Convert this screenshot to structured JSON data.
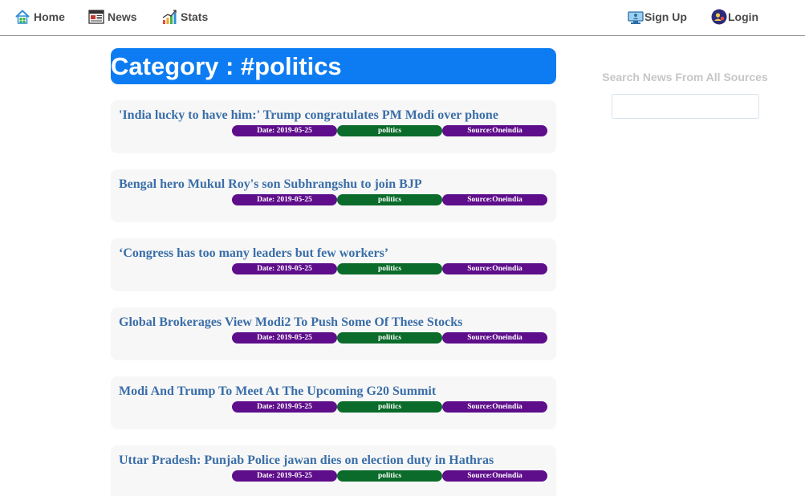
{
  "nav": {
    "left": [
      {
        "label": "Home",
        "icon": "home-icon"
      },
      {
        "label": "News",
        "icon": "newspaper-icon"
      },
      {
        "label": "Stats",
        "icon": "chart-icon"
      }
    ],
    "right": [
      {
        "label": "Sign Up",
        "icon": "signup-monitor-icon"
      },
      {
        "label": "Login",
        "icon": "login-user-icon"
      }
    ]
  },
  "category": {
    "heading": "Category : #politics"
  },
  "articles": [
    {
      "title": "'India lucky to have him:' Trump congratulates PM Modi over phone",
      "date": "Date: 2019-05-25",
      "category": "politics",
      "source": "Source:Oneindia"
    },
    {
      "title": "Bengal hero Mukul Roy's son Subhrangshu to join BJP",
      "date": "Date: 2019-05-25",
      "category": "politics",
      "source": "Source:Oneindia"
    },
    {
      "title": "‘Congress has too many leaders but few workers’",
      "date": "Date: 2019-05-25",
      "category": "politics",
      "source": "Source:Oneindia"
    },
    {
      "title": "Global Brokerages View Modi2 To Push Some Of These Stocks",
      "date": "Date: 2019-05-25",
      "category": "politics",
      "source": "Source:Oneindia"
    },
    {
      "title": "Modi And Trump To Meet At The Upcoming G20 Summit",
      "date": "Date: 2019-05-25",
      "category": "politics",
      "source": "Source:Oneindia"
    },
    {
      "title": "Uttar Pradesh: Punjab Police jawan dies on election duty in Hathras",
      "date": "Date: 2019-05-25",
      "category": "politics",
      "source": "Source:Oneindia"
    }
  ],
  "sidebar": {
    "search_heading": "Search News From All Sources",
    "search_value": ""
  },
  "colors": {
    "banner": "#0d7cf2",
    "title_link": "#3a6ea8",
    "badge_purple": "#5e0d8b",
    "badge_green": "#0a6b2a"
  }
}
